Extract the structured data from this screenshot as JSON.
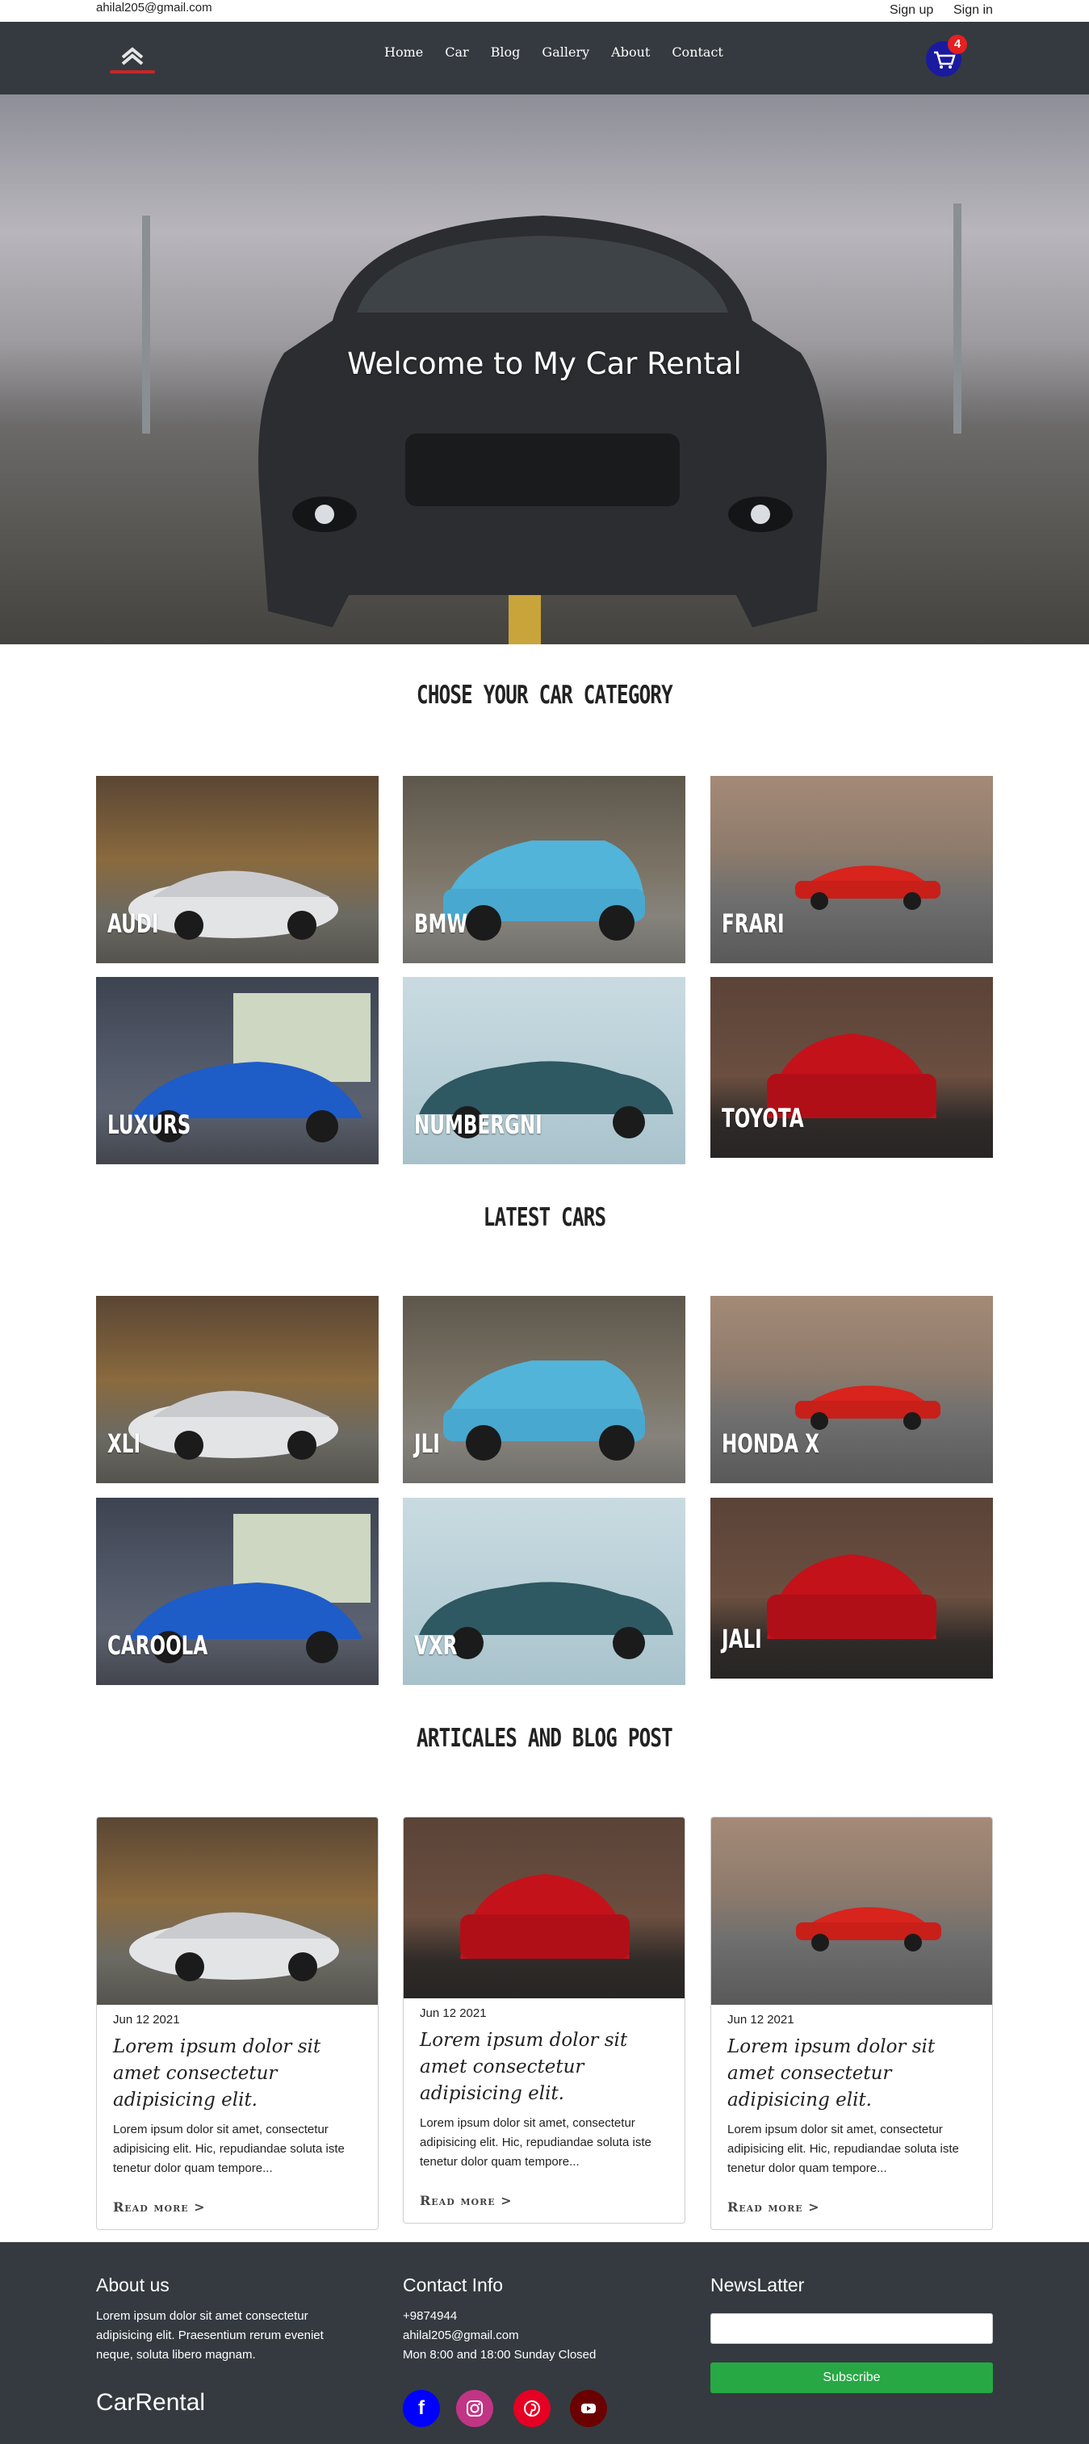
{
  "topbar": {
    "email": "ahilal205@gmail.com",
    "signup": "Sign up",
    "signin": "Sign in"
  },
  "nav": {
    "items": [
      "Home",
      "Car",
      "Blog",
      "Gallery",
      "About",
      "Contact"
    ],
    "cart_count": "4"
  },
  "hero": {
    "title": "Welcome to My Car Rental"
  },
  "categories": {
    "title": "CHOSE YOUR CAR CATEGORY",
    "items": [
      "AUDI",
      "BMW",
      "FRARI",
      "LUXURS",
      "NUMBERGNI",
      "TOYOTA"
    ]
  },
  "latest": {
    "title": "LATEST CARS",
    "items": [
      "XLI",
      "JLI",
      "HONDA X",
      "CAROOLA",
      "VXR",
      "JALI"
    ]
  },
  "blog": {
    "title": "ARTICALES AND BLOG POST",
    "posts": [
      {
        "date": "Jun 12 2021",
        "heading": "Lorem ipsum dolor sit amet consectetur adipisicing elit.",
        "body": "Lorem ipsum dolor sit amet, consectetur adipisicing elit. Hic, repudiandae soluta iste tenetur dolor quam tempore...",
        "more": "Read more >"
      },
      {
        "date": "Jun 12 2021",
        "heading": "Lorem ipsum dolor sit amet consectetur adipisicing elit.",
        "body": "Lorem ipsum dolor sit amet, consectetur adipisicing elit. Hic, repudiandae soluta iste tenetur dolor quam tempore...",
        "more": "Read more >"
      },
      {
        "date": "Jun 12 2021",
        "heading": "Lorem ipsum dolor sit amet consectetur adipisicing elit.",
        "body": "Lorem ipsum dolor sit amet, consectetur adipisicing elit. Hic, repudiandae soluta iste tenetur dolor quam tempore...",
        "more": "Read more >"
      }
    ]
  },
  "footer": {
    "about_title": "About us",
    "about_text": "Lorem ipsum dolor sit amet consectetur adipisicing elit. Praesentium rerum eveniet neque, soluta libero magnam.",
    "brand": "CarRental",
    "contact_title": "Contact Info",
    "phone": "+9874944",
    "email": "ahilal205@gmail.com",
    "hours": "Mon 8:00 and 18:00 Sunday Closed",
    "news_title": "NewsLatter",
    "subscribe": "Subscribe",
    "social": [
      "facebook-icon",
      "instagram-icon",
      "pinterest-icon",
      "youtube-icon"
    ],
    "colors": {
      "facebook": "#0000ff",
      "instagram": "#c13584",
      "pinterest": "#e60023",
      "youtube": "#6b0000"
    }
  },
  "colors": {
    "navbar": "#343a40",
    "accent": "#28a745"
  }
}
